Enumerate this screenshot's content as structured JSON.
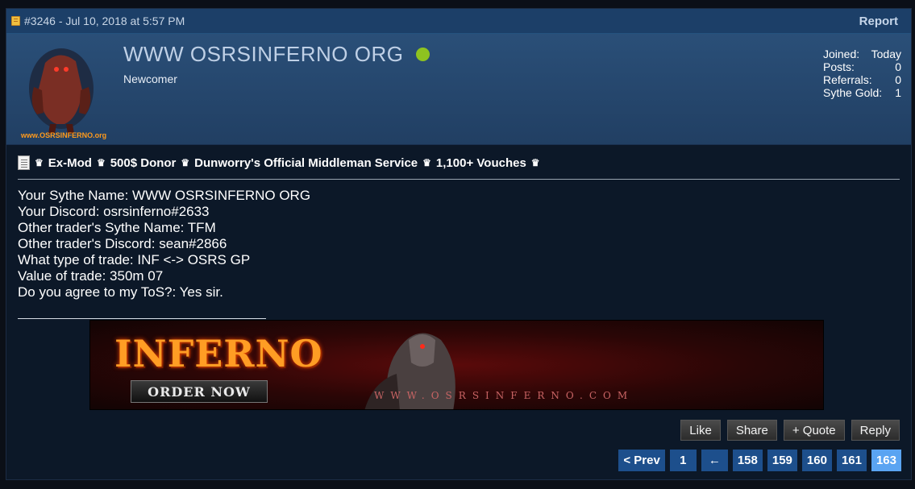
{
  "post": {
    "meta": "#3246 - Jul 10, 2018 at 5:57 PM",
    "report_label": "Report"
  },
  "user": {
    "name": "WWW OSRSINFERNO ORG",
    "title": "Newcomer",
    "online_color": "#8ec320",
    "avatar_caption": "www.OSRSINFERNO.org",
    "stats": [
      {
        "label": "Joined:",
        "value": "Today"
      },
      {
        "label": "Posts:",
        "value": "0"
      },
      {
        "label": "Referrals:",
        "value": "0"
      },
      {
        "label": "Sythe Gold:",
        "value": "1"
      }
    ]
  },
  "signature": {
    "items": [
      "Ex-Mod",
      "500$ Donor",
      "Dunworry's Official Middleman Service",
      "1,100+ Vouches"
    ],
    "crown_glyph": "♛"
  },
  "content": {
    "lines": [
      "Your Sythe Name: WWW OSRSINFERNO ORG",
      "Your Discord: osrsinferno#2633",
      "Other trader's Sythe Name: TFM",
      "Other trader's Discord: sean#2866",
      "What type of trade: INF <-> OSRS GP",
      "Value of trade: 350m 07",
      "Do you agree to my ToS?: Yes sir."
    ]
  },
  "banner": {
    "title": "INFERNO",
    "order_label": "ORDER NOW",
    "url": "WWW.OSRSINFERNO.COM"
  },
  "actions": {
    "like": "Like",
    "share": "Share",
    "quote": "+ Quote",
    "reply": "Reply"
  },
  "pagination": {
    "prev": "< Prev",
    "first": "1",
    "arrow": "←",
    "pages": [
      "158",
      "159",
      "160",
      "161",
      "163"
    ],
    "current": "163"
  },
  "colors": {
    "header_bg": "#1c3f68",
    "page_button": "#1d4f8c",
    "page_button_active": "#5aa4f2"
  }
}
